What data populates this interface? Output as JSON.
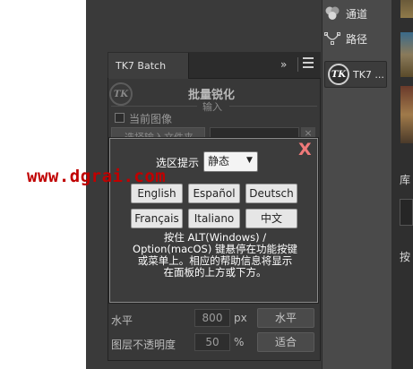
{
  "right_panel": {
    "items": [
      {
        "label": "通道",
        "icon": "channels-icon"
      },
      {
        "label": "路径",
        "icon": "paths-icon"
      }
    ],
    "plugin_item": {
      "logo": "TK",
      "label": "TK7 ..."
    },
    "side_labels": [
      "库",
      "按"
    ]
  },
  "panel": {
    "tab_title": "TK7 Batch",
    "collapse_glyph": "»",
    "logo": "TK",
    "title": "批量锐化",
    "section_input": "输入",
    "current_image_label": "当前图像",
    "select_input_button": "选择输入文件夹",
    "clear_glyph": "×",
    "rows": [
      {
        "label": "水平",
        "value": "800",
        "unit": "px",
        "button": "水平"
      },
      {
        "label": "图层不透明度",
        "value": "50",
        "unit": "%",
        "button": "适合"
      }
    ]
  },
  "dialog": {
    "close_glyph": "X",
    "hint_label": "选区提示",
    "hint_value": "静态",
    "hint_caret": "▼",
    "languages": [
      "English",
      "Español",
      "Deutsch",
      "Français",
      "Italiano",
      "中文"
    ],
    "help_lines": [
      "按住 ALT(Windows) /",
      "Option(macOS) 键悬停在功能按键",
      "或菜单上。相应的帮助信息将显示",
      "在面板的上方或下方。"
    ]
  },
  "watermark": "www.dgrai.com",
  "colors": {
    "workspace": "#3a3a3a",
    "dialog_border": "#8a8a8a",
    "close_accent": "#f07a7a",
    "watermark": "#c00000"
  }
}
